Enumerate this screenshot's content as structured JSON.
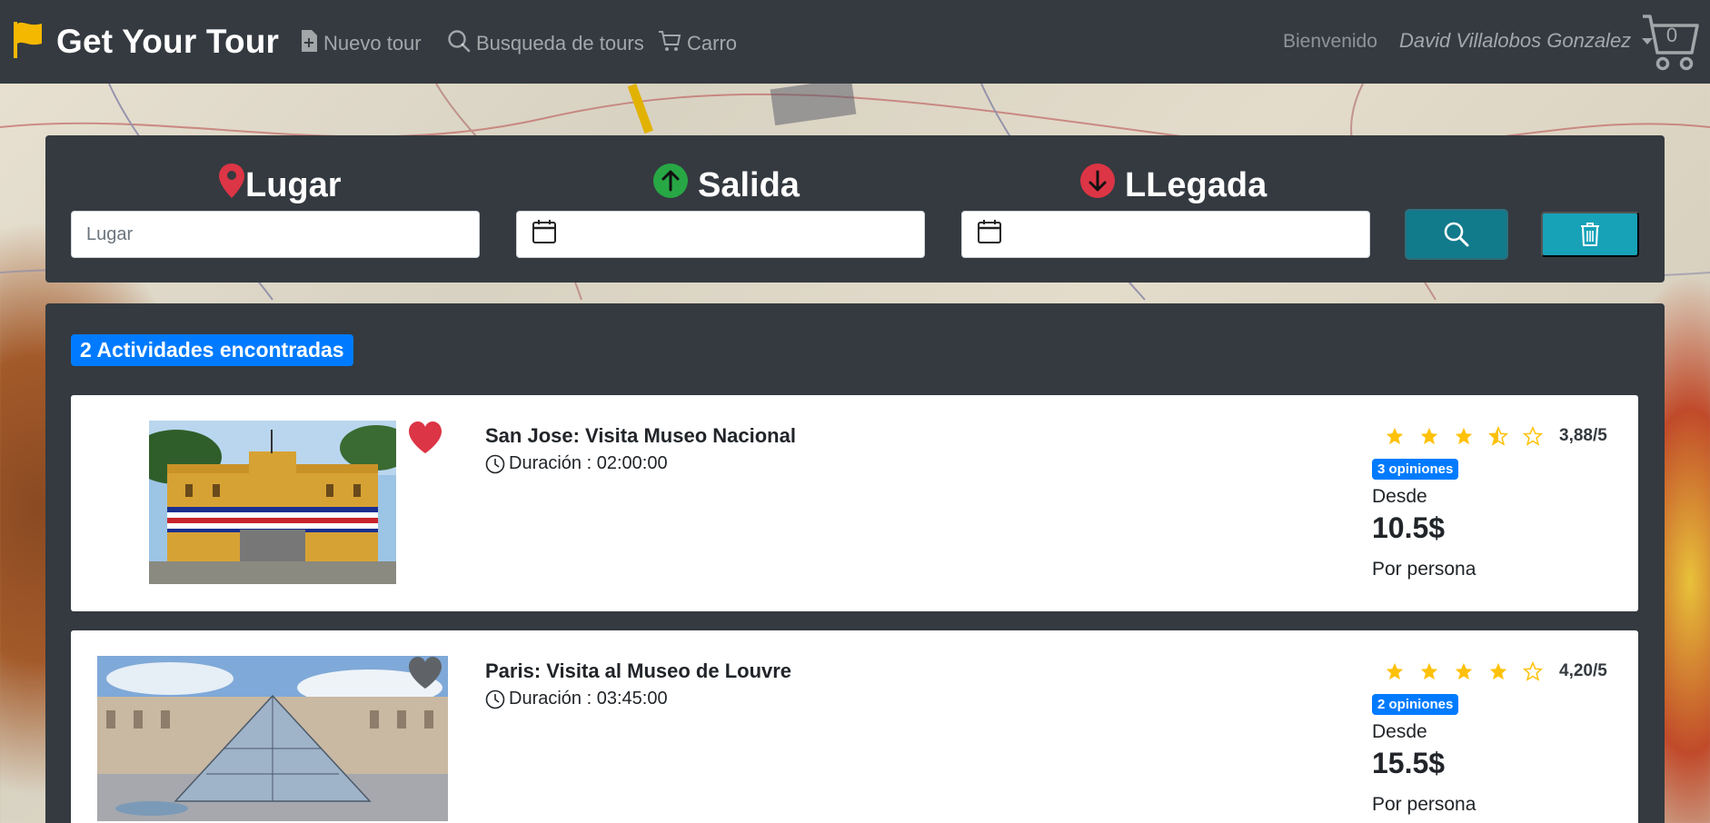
{
  "navbar": {
    "brand": "Get Your Tour",
    "items": [
      {
        "label": "Nuevo tour",
        "icon": "file-plus-icon"
      },
      {
        "label": "Busqueda de tours",
        "icon": "search-icon"
      },
      {
        "label": "Carro",
        "icon": "cart-icon"
      }
    ],
    "welcome": "Bienvenido",
    "user": "David Villalobos Gonzalez",
    "cart_count": "0"
  },
  "search": {
    "lugar_label": "Lugar",
    "lugar_placeholder": "Lugar",
    "salida_label": "Salida",
    "llegada_label": "LLegada"
  },
  "results": {
    "count_label": "2 Actividades encontradas",
    "desde_label": "Desde",
    "per_person_label": "Por persona",
    "tours": [
      {
        "title": "San Jose: Visita Museo Nacional",
        "duration": "Duración : 02:00:00",
        "rating_value": 3.88,
        "rating_text": "3,88/5",
        "reviews": "3 opiniones",
        "price": "10.5$",
        "favorite": true
      },
      {
        "title": "Paris: Visita al Museo de Louvre",
        "duration": "Duración : 03:45:00",
        "rating_value": 4.2,
        "rating_text": "4,20/5",
        "reviews": "2 opiniones",
        "price": "15.5$",
        "favorite": false
      }
    ]
  },
  "colors": {
    "navbar_bg": "#343a40",
    "primary": "#007bff",
    "info": "#17a2b8",
    "star": "#ffc107",
    "danger": "#dc3545",
    "success": "#28a745"
  }
}
